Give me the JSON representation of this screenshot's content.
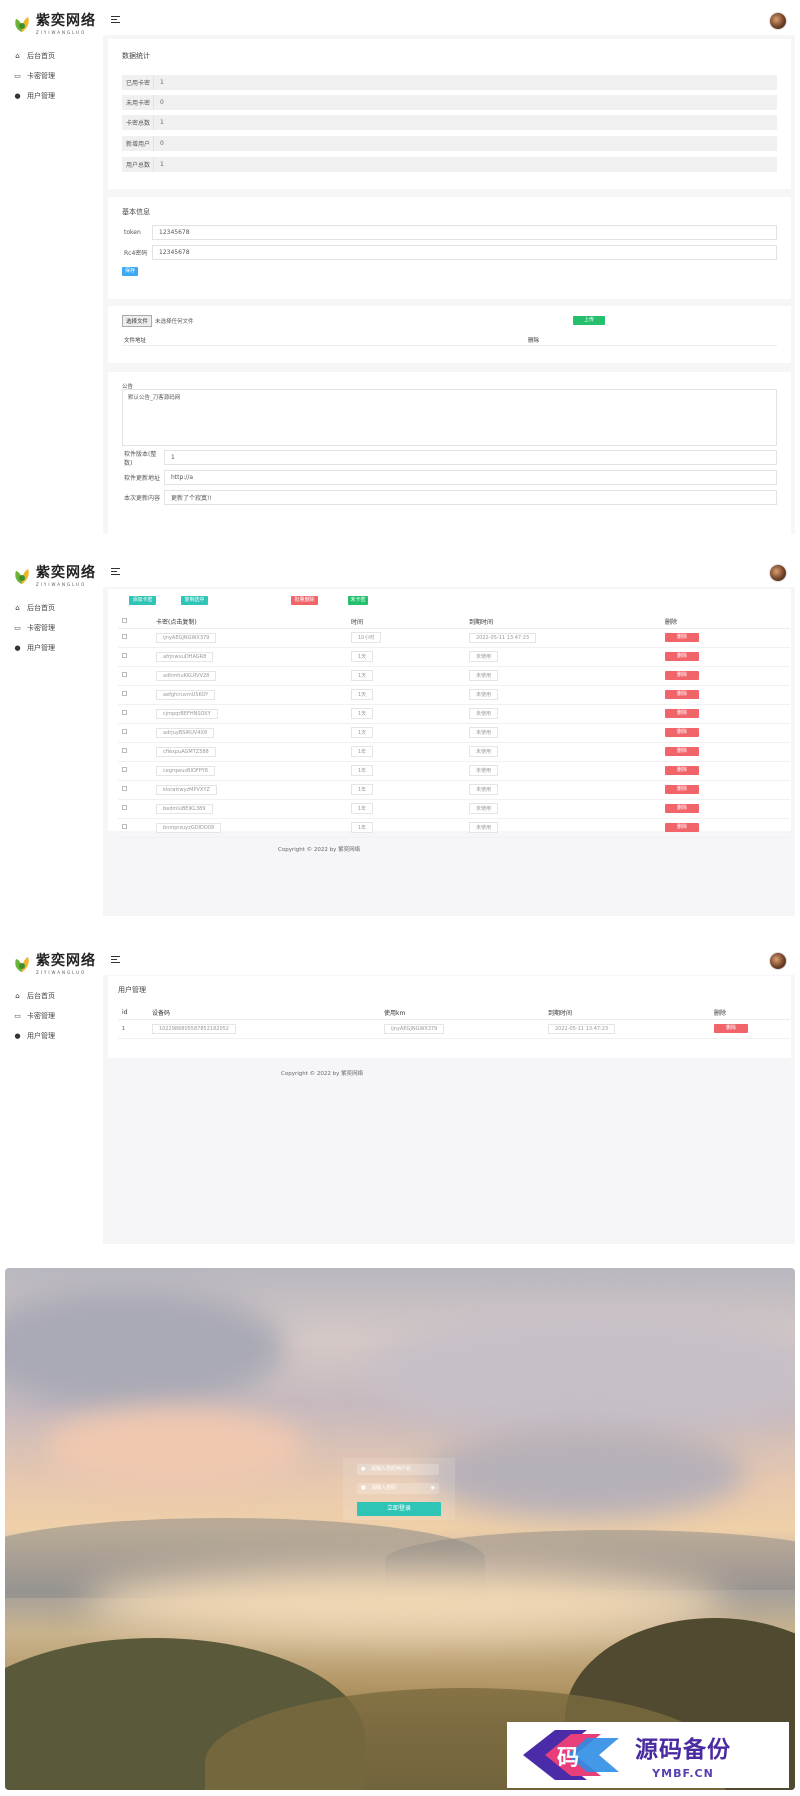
{
  "brand": {
    "name_cn": "紫奕网络",
    "name_en": "ZIYIWANGLUO"
  },
  "nav": [
    {
      "label": "后台首页",
      "icon": "home-icon"
    },
    {
      "label": "卡密管理",
      "icon": "card-icon"
    },
    {
      "label": "用户管理",
      "icon": "user-icon"
    }
  ],
  "dashboard": {
    "stats_title": "数据统计",
    "stats": [
      {
        "label": "已用卡密",
        "value": "1"
      },
      {
        "label": "未用卡密",
        "value": "0"
      },
      {
        "label": "卡密总数",
        "value": "1"
      },
      {
        "label": "新增用户",
        "value": "0"
      },
      {
        "label": "用户总数",
        "value": "1"
      }
    ],
    "basic_title": "基本信息",
    "token_label": "token",
    "token_value": "12345678",
    "rc4_label": "Rc4密码",
    "rc4_value": "12345678",
    "save_label": "保存",
    "file_choose_label": "选择文件",
    "file_none_label": "未选择任何文件",
    "upload_label": "上传",
    "file_col_address": "文件地址",
    "file_col_delete": "删除",
    "notice_label": "公告",
    "notice_value": "默认公告_刀客源码网",
    "version_label": "软件版本(整数)",
    "version_value": "1",
    "update_url_label": "软件更新地址",
    "update_url_value": "http://a",
    "update_content_label": "本次更新内容",
    "update_content_value": "更新了个寂寞!!"
  },
  "cards": {
    "add_label": "添加卡密",
    "export_label": "复制选中",
    "batch_delete_label": "批量删除",
    "unused_label": "未卡密",
    "columns": [
      "卡密(点击复制)",
      "时间",
      "到期时间",
      "删除"
    ],
    "rows": [
      {
        "code": "ijnyAEGJNGWX379",
        "time": "10小时",
        "expire": "2022-05-11 13:47:23"
      },
      {
        "code": "afrjnwuuDHAGR8",
        "time": "1天",
        "expire": "未使用"
      },
      {
        "code": "adhmhuKKLRVV28",
        "time": "1天",
        "expire": "未使用"
      },
      {
        "code": "aefghiruvmUSKOY",
        "time": "1天",
        "expire": "未使用"
      },
      {
        "code": "cjmpqrBEFHNSOXY",
        "time": "1天",
        "expire": "未使用"
      },
      {
        "code": "adrjuyBSIRUV4X8",
        "time": "1天",
        "expire": "未使用"
      },
      {
        "code": "cflexpuAGMTZ588",
        "time": "1年",
        "expire": "未使用"
      },
      {
        "code": "cegrqwuzBIOFPY8",
        "time": "1年",
        "expire": "未使用"
      },
      {
        "code": "kloratrwyzMPVXYZ",
        "time": "1年",
        "expire": "未使用"
      },
      {
        "code": "bedmluBEIKL389",
        "time": "1年",
        "expire": "未使用"
      },
      {
        "code": "bnmprzuyzGDIDO08",
        "time": "1年",
        "expire": "未使用"
      }
    ],
    "delete_label": "删除",
    "footer": "Copyright © 2022 by 紫奕网络"
  },
  "users": {
    "title": "用户管理",
    "columns": [
      "id",
      "设备码",
      "使用km",
      "到期时间",
      "删除"
    ],
    "rows": [
      {
        "id": "1",
        "device": "1022986805587852182052",
        "km": "ijnyAEGJNGWX379",
        "expire": "2022-05-11 13:47:23"
      }
    ],
    "delete_label": "删除",
    "footer": "Copyright © 2022 by 紫奕网络"
  },
  "login": {
    "username_placeholder": "请输入您的用户名",
    "password_placeholder": "请输入密码",
    "submit_label": "立即登录"
  },
  "watermark": {
    "cn": "源码备份",
    "en": "YMBF.CN",
    "glyph": "码"
  }
}
